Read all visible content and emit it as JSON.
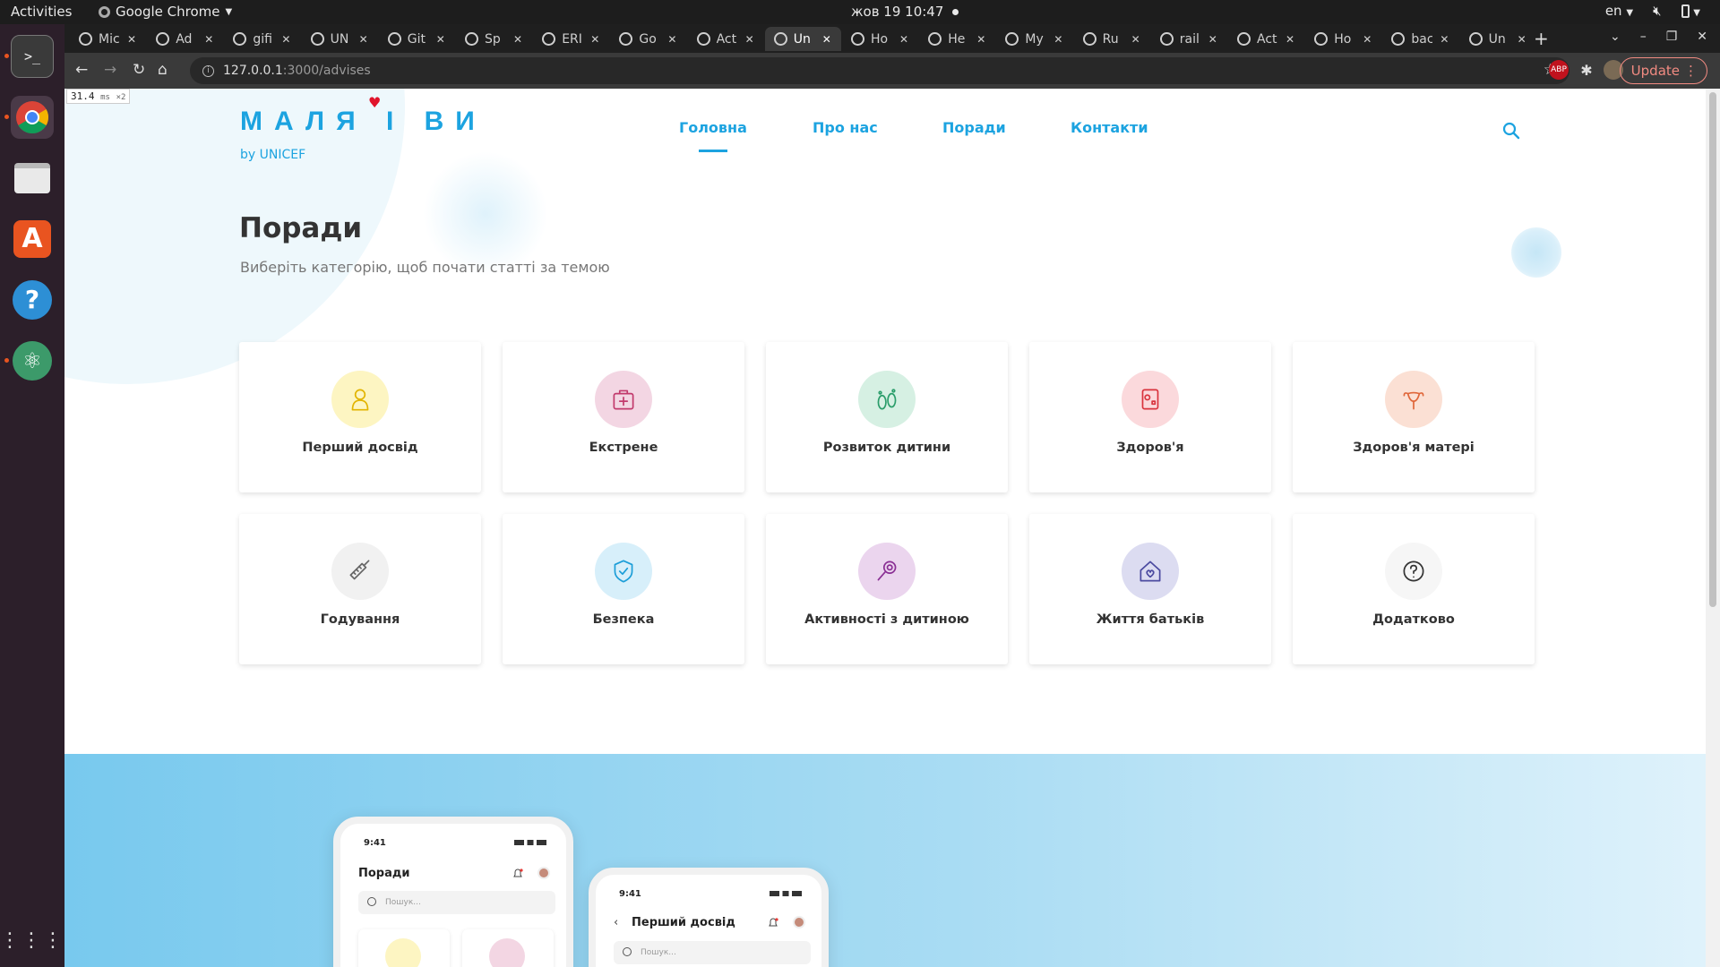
{
  "system": {
    "activities": "Activities",
    "app_name": "Google Chrome",
    "clock": "жов 19  10:47",
    "lang": "en"
  },
  "tabs": [
    {
      "title": "Mic"
    },
    {
      "title": "Ad"
    },
    {
      "title": "gifi"
    },
    {
      "title": "UN"
    },
    {
      "title": "Git"
    },
    {
      "title": "Sp"
    },
    {
      "title": "ERI"
    },
    {
      "title": "Go"
    },
    {
      "title": "Act"
    },
    {
      "title": "Un",
      "active": true
    },
    {
      "title": "Ho"
    },
    {
      "title": "He"
    },
    {
      "title": "My"
    },
    {
      "title": "Ru"
    },
    {
      "title": "rail"
    },
    {
      "title": "Act"
    },
    {
      "title": "Ho"
    },
    {
      "title": "bac"
    },
    {
      "title": "Un"
    }
  ],
  "browser": {
    "url_host": "127.0.0.1",
    "url_path": ":3000/advises",
    "update_label": "Update",
    "abp_label": "ABP"
  },
  "perf": {
    "value": "31.4",
    "unit": "ms",
    "mult": "×2"
  },
  "site": {
    "logo": "МАЛЯ І ВИ",
    "logo_sub": "by UNICEF",
    "nav": [
      "Головна",
      "Про нас",
      "Поради",
      "Контакти"
    ],
    "title": "Поради",
    "subtitle": "Виберіть категорію, щоб почати статті за темою"
  },
  "categories": [
    {
      "label": "Перший досвід",
      "color": "#fdf5c2",
      "stroke": "#e2b400",
      "icon": "baby-icon"
    },
    {
      "label": "Екстрене",
      "color": "#f3d6e3",
      "stroke": "#c23a6d",
      "icon": "first-aid-kit-icon"
    },
    {
      "label": "Розвиток дитини",
      "color": "#d6f0e3",
      "stroke": "#2a9d6a",
      "icon": "baby-feet-icon"
    },
    {
      "label": "Здоров'я",
      "color": "#fbd9dc",
      "stroke": "#d9343e",
      "icon": "medicine-icon"
    },
    {
      "label": "Здоров'я матері",
      "color": "#fbe0d4",
      "stroke": "#e0673a",
      "icon": "uterus-icon"
    },
    {
      "label": "Годування",
      "color": "#f1f1f1",
      "stroke": "#666666",
      "icon": "baby-bottle-icon"
    },
    {
      "label": "Безпека",
      "color": "#d7effa",
      "stroke": "#1c9ed8",
      "icon": "shield-icon"
    },
    {
      "label": "Активності з дитиною",
      "color": "#ebd5ee",
      "stroke": "#8a2f94",
      "icon": "rattle-icon"
    },
    {
      "label": "Життя батьків",
      "color": "#dcdcf1",
      "stroke": "#4b4aa0",
      "icon": "house-heart-icon"
    },
    {
      "label": "Додатково",
      "color": "#f6f6f6",
      "stroke": "#333333",
      "icon": "question-icon"
    }
  ],
  "phones": [
    {
      "time": "9:41",
      "title": "Поради",
      "search": "Пошук..."
    },
    {
      "time": "9:41",
      "title": "Перший досвід",
      "search": "Пошук..."
    }
  ]
}
